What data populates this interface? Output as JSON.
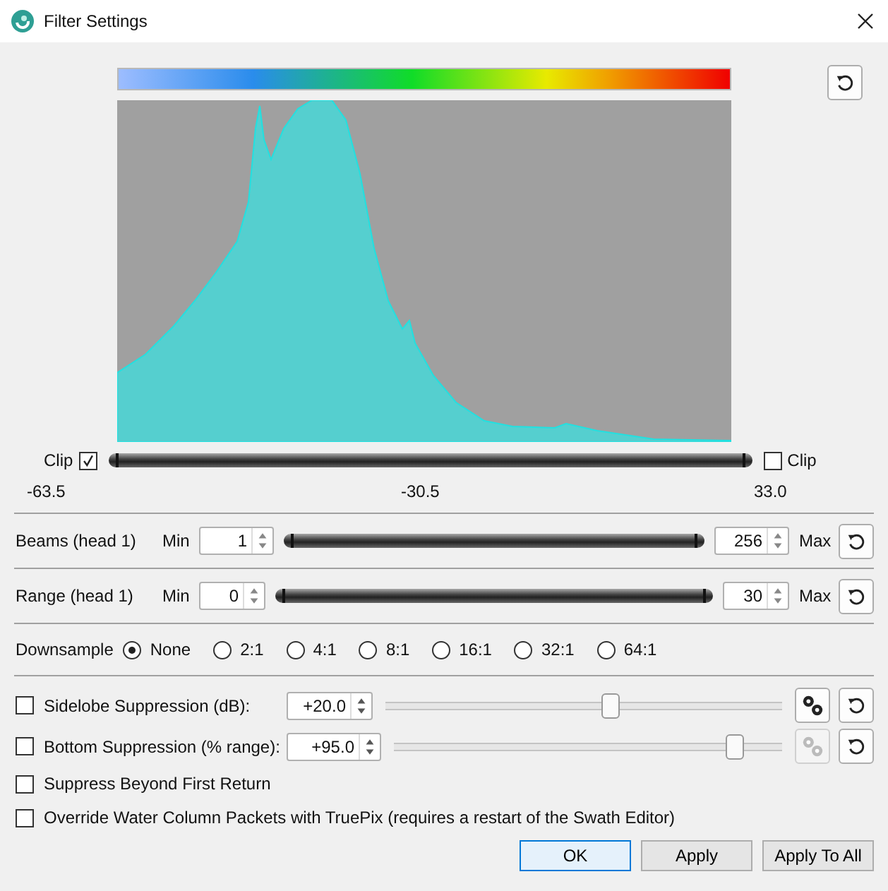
{
  "window": {
    "title": "Filter Settings"
  },
  "histogram": {
    "clip_low": {
      "label": "Clip",
      "checked": true
    },
    "clip_high": {
      "label": "Clip",
      "checked": false
    },
    "handles": [
      {
        "level": 0
      },
      {
        "level": 1
      }
    ],
    "min_label": "-63.5",
    "mid_label": "-30.5",
    "max_label": "33.0"
  },
  "ranges": [
    {
      "label": "Beams (head 1)",
      "min_label": "Min",
      "min": "1",
      "max": "256",
      "max_label": "Max",
      "handles": [
        {
          "level": 0
        },
        {
          "level": 1
        }
      ]
    },
    {
      "label": "Range (head 1)",
      "min_label": "Min",
      "min": "0",
      "max": "30",
      "max_label": "Max",
      "handles": [
        {
          "level": 0
        },
        {
          "level": 1
        }
      ]
    }
  ],
  "downsample": {
    "label": "Downsample",
    "options": [
      {
        "label": "None",
        "selected": true
      },
      {
        "label": "2:1",
        "selected": false
      },
      {
        "label": "4:1",
        "selected": false
      },
      {
        "label": "8:1",
        "selected": false
      },
      {
        "label": "16:1",
        "selected": false
      },
      {
        "label": "32:1",
        "selected": false
      },
      {
        "label": "64:1",
        "selected": false
      }
    ]
  },
  "suppression": [
    {
      "label": "Sidelobe Suppression (dB):",
      "checked": false,
      "value": "+20.0",
      "level": 0.57,
      "settings_disabled": false
    },
    {
      "label": "Bottom Suppression (% range):",
      "checked": false,
      "value": "+95.0",
      "level": 0.88,
      "settings_disabled": true
    }
  ],
  "options": [
    {
      "label": "Suppress Beyond First Return",
      "checked": false
    },
    {
      "label": "Override Water Column Packets with TruePix (requires a restart of the Swath Editor)",
      "checked": false
    }
  ],
  "buttons": [
    {
      "label": "OK",
      "default": true
    },
    {
      "label": "Apply",
      "default": false
    },
    {
      "label": "Apply To All",
      "default": false
    }
  ]
}
